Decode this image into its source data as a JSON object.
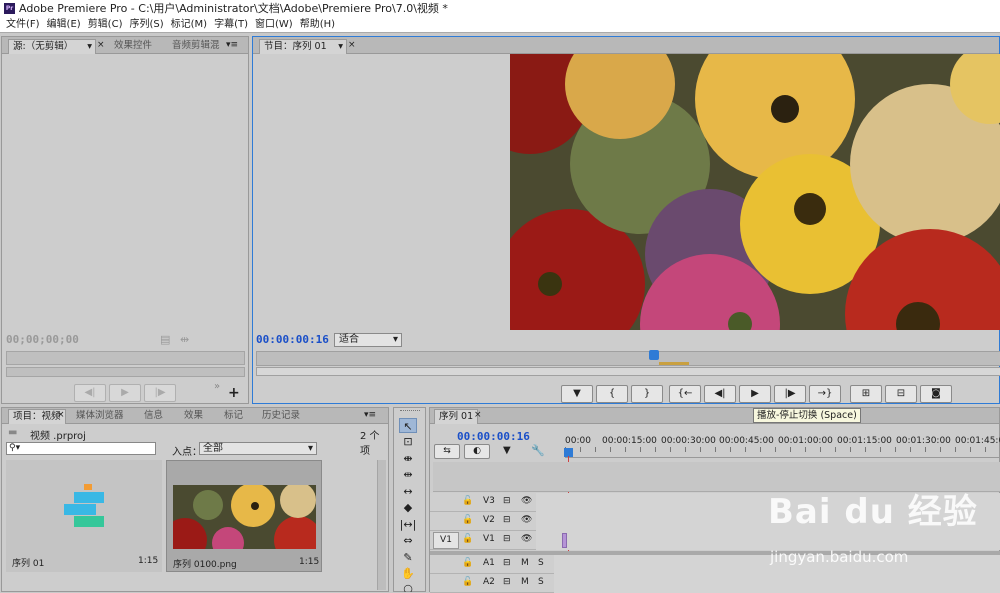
{
  "title_bar": {
    "logo": "Pr",
    "title": "Adobe Premiere Pro - C:\\用户\\Administrator\\文档\\Adobe\\Premiere Pro\\7.0\\视频 *"
  },
  "menu": [
    "文件(F)",
    "编辑(E)",
    "剪辑(C)",
    "序列(S)",
    "标记(M)",
    "字幕(T)",
    "窗口(W)",
    "帮助(H)"
  ],
  "source_panel": {
    "tabs": [
      "源:（无剪辑）",
      "效果控件",
      "音频剪辑混"
    ],
    "timecode": "00;00;00;00"
  },
  "program_panel": {
    "tab": "节目：序列 01",
    "timecode": "00:00:00:16",
    "fit": "适合",
    "tooltip": "播放-停止切换 (Space)"
  },
  "project_panel": {
    "tabs": [
      "项目：视频",
      "媒体浏览器",
      "信息",
      "效果",
      "标记",
      "历史记录"
    ],
    "file": "视频 .prproj",
    "count": "2 个项",
    "search_placeholder": "",
    "in_label": "入点：",
    "in_value": "全部",
    "items": [
      {
        "name": "序列 01",
        "duration": "1:15"
      },
      {
        "name": "序列 0100.png",
        "duration": "1:15"
      }
    ]
  },
  "timeline": {
    "tab": "序列 01",
    "timecode": "00:00:00:16",
    "ruler": [
      "00:00",
      "00:00:15:00",
      "00:00:30:00",
      "00:00:45:00",
      "00:01:00:00",
      "00:01:15:00",
      "00:01:30:00",
      "00:01:45:00"
    ],
    "tracks": [
      {
        "src": "",
        "name": "V3"
      },
      {
        "src": "",
        "name": "V2"
      },
      {
        "src": "V1",
        "name": "V1"
      },
      {
        "src": "",
        "name": "A1"
      },
      {
        "src": "",
        "name": "A2"
      }
    ],
    "m": "M",
    "s": "S"
  },
  "watermark": {
    "url": "jingyan.baidu.com",
    "brand": "Bai du 经验"
  }
}
